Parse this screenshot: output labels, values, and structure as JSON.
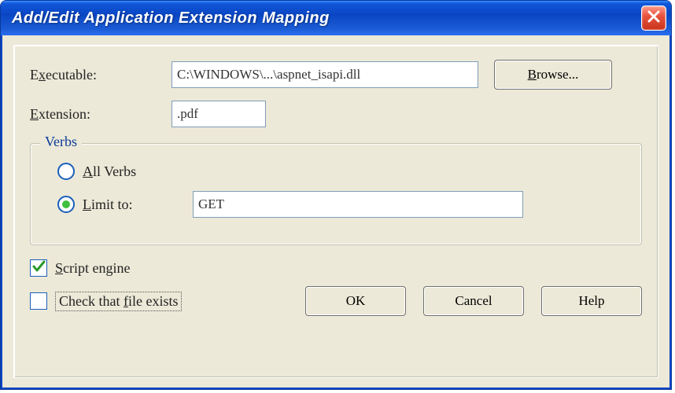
{
  "window": {
    "title": "Add/Edit Application Extension Mapping"
  },
  "labels": {
    "executable_pre": "E",
    "executable_accel": "x",
    "executable_post": "ecutable:",
    "extension_accel": "E",
    "extension_post": "xtension:",
    "browse_accel": "B",
    "browse_post": "rowse...",
    "verbs": "Verbs",
    "allverbs_accel": "A",
    "allverbs_post": "ll Verbs",
    "limit_accel": "L",
    "limit_post": "imit to:",
    "script_accel": "S",
    "script_post": "cript engine",
    "checkfile_pre": "Check that ",
    "checkfile_accel": "f",
    "checkfile_post": "ile exists",
    "ok": "OK",
    "cancel": "Cancel",
    "help": "Help"
  },
  "fields": {
    "executable": "C:\\WINDOWS\\...\\aspnet_isapi.dll",
    "extension": ".pdf",
    "limit_to": "GET"
  },
  "state": {
    "verbs_mode": "limit",
    "script_engine_checked": true,
    "check_file_exists_checked": false
  }
}
